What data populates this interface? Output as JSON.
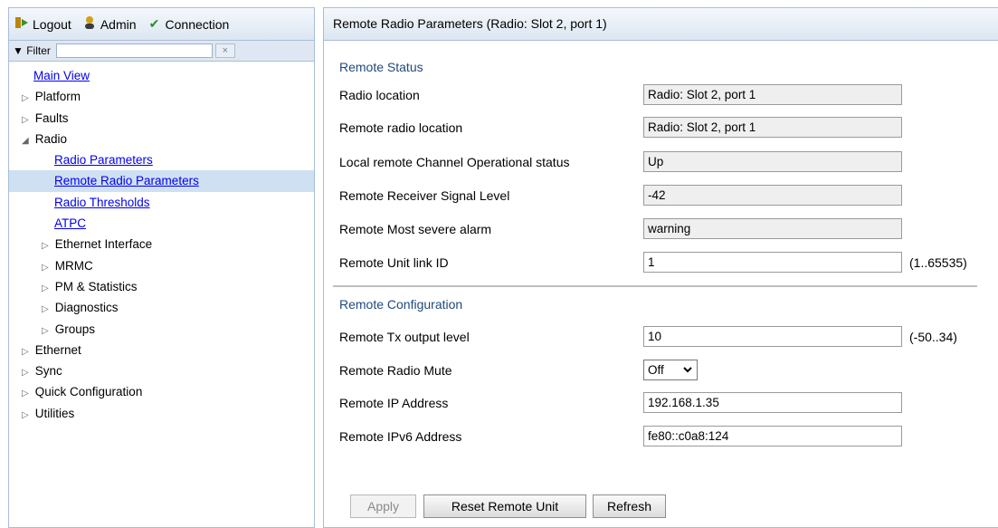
{
  "toolbar": {
    "logout": "Logout",
    "admin": "Admin",
    "connection": "Connection",
    "icons": {
      "logout": "logout-icon",
      "admin": "admin-user-icon",
      "connection": "checkmark-icon"
    }
  },
  "filter": {
    "label": "▼ Filter",
    "value": "",
    "clear": "×"
  },
  "tree": {
    "main_view": "Main View",
    "platform": "Platform",
    "faults": "Faults",
    "radio": "Radio",
    "radio_children": {
      "radio_parameters": "Radio Parameters",
      "remote_radio_parameters": "Remote Radio Parameters",
      "radio_thresholds": "Radio Thresholds",
      "atpc": "ATPC",
      "ethernet_interface": "Ethernet Interface",
      "mrmc": "MRMC",
      "pm_statistics": "PM & Statistics",
      "diagnostics": "Diagnostics",
      "groups": "Groups"
    },
    "ethernet": "Ethernet",
    "sync": "Sync",
    "quick_configuration": "Quick Configuration",
    "utilities": "Utilities",
    "expanded_arrow": "◢",
    "collapsed_arrow": "▷"
  },
  "page": {
    "title": "Remote Radio Parameters (Radio: Slot 2, port 1)",
    "remote_status_header": "Remote Status",
    "radio_location": {
      "label": "Radio location",
      "value": "Radio: Slot 2, port 1"
    },
    "remote_radio_location": {
      "label": "Remote radio location",
      "value": "Radio: Slot 2, port 1"
    },
    "channel_status": {
      "label": "Local remote Channel Operational status",
      "value": "Up"
    },
    "rsl": {
      "label": "Remote Receiver Signal Level",
      "value": "-42"
    },
    "severe_alarm": {
      "label": "Remote Most severe alarm",
      "value": "warning"
    },
    "unit_link_id": {
      "label": "Remote Unit link ID",
      "value": "1",
      "hint": "(1..65535)"
    },
    "remote_config_header": "Remote Configuration",
    "tx_output": {
      "label": "Remote Tx output level",
      "value": "10",
      "hint": "(-50..34)"
    },
    "radio_mute": {
      "label": "Remote Radio Mute",
      "value": "Off"
    },
    "ip_address": {
      "label": "Remote IP Address",
      "value": "192.168.1.35"
    },
    "ipv6_address": {
      "label": "Remote IPv6 Address",
      "value": "fe80::c0a8:124"
    }
  },
  "buttons": {
    "apply": "Apply",
    "reset": "Reset Remote Unit",
    "refresh": "Refresh"
  },
  "colors": {
    "link": "#0000ee",
    "section_header": "#1f497d",
    "selected_row": "#cfe0f3"
  }
}
